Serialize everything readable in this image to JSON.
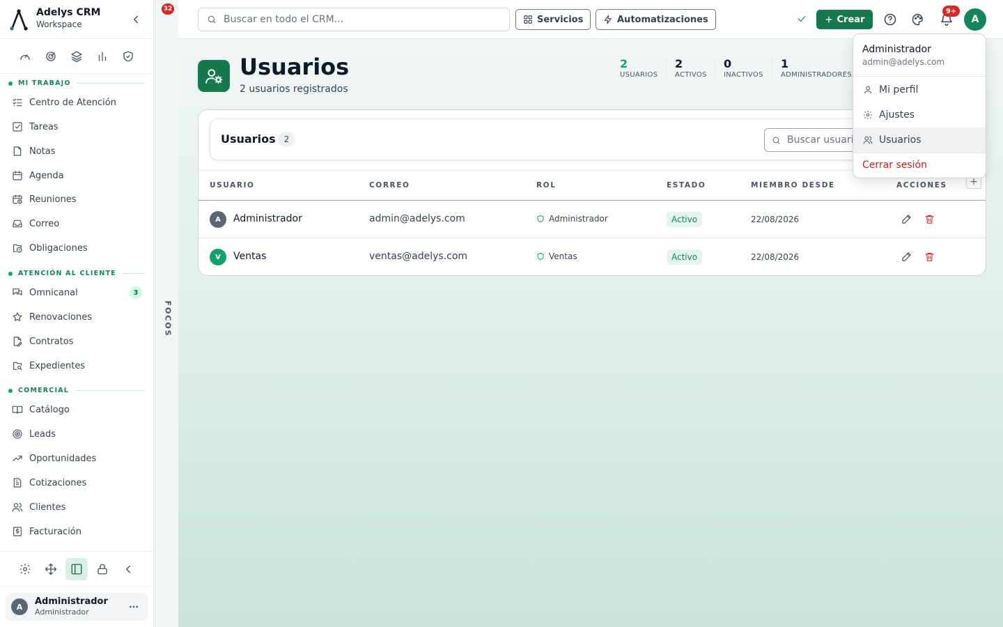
{
  "brand": {
    "name": "Adelys CRM",
    "subtitle": "Workspace"
  },
  "sidebar": {
    "sections": [
      {
        "title": "MI TRABAJO",
        "items": [
          {
            "label": "Centro de Atención",
            "icon": "list-check-icon"
          },
          {
            "label": "Tareas",
            "icon": "checkbox-icon"
          },
          {
            "label": "Notas",
            "icon": "note-icon"
          },
          {
            "label": "Agenda",
            "icon": "calendar-icon"
          },
          {
            "label": "Reuniones",
            "icon": "calendar-clock-icon"
          },
          {
            "label": "Correo",
            "icon": "inbox-icon"
          },
          {
            "label": "Obligaciones",
            "icon": "folder-clock-icon"
          }
        ]
      },
      {
        "title": "ATENCIÓN AL CLIENTE",
        "items": [
          {
            "label": "Omnicanal",
            "icon": "chat-icon",
            "badge": "3"
          },
          {
            "label": "Renovaciones",
            "icon": "star-icon"
          },
          {
            "label": "Contratos",
            "icon": "file-edit-icon"
          },
          {
            "label": "Expedientes",
            "icon": "folder-search-icon"
          }
        ]
      },
      {
        "title": "COMERCIAL",
        "items": [
          {
            "label": "Catálogo",
            "icon": "book-icon"
          },
          {
            "label": "Leads",
            "icon": "target-icon"
          },
          {
            "label": "Oportunidades",
            "icon": "trend-icon"
          },
          {
            "label": "Cotizaciones",
            "icon": "document-icon"
          },
          {
            "label": "Clientes",
            "icon": "users-icon"
          },
          {
            "label": "Facturación",
            "icon": "invoice-icon"
          }
        ]
      }
    ],
    "user": {
      "initial": "A",
      "name": "Administrador",
      "role": "Administrador"
    }
  },
  "focus": {
    "badge": "32",
    "label": "FOCOS"
  },
  "topbar": {
    "search_placeholder": "Buscar en todo el CRM...",
    "services_label": "Servicios",
    "automations_label": "Automatizaciones",
    "create_label": "Crear",
    "notifications_badge": "9+",
    "avatar_initial": "A"
  },
  "page": {
    "title": "Usuarios",
    "subtitle": "2 usuarios registrados",
    "stats": [
      {
        "value": "2",
        "label": "USUARIOS"
      },
      {
        "value": "2",
        "label": "ACTIVOS"
      },
      {
        "value": "0",
        "label": "INACTIVOS"
      },
      {
        "value": "1",
        "label": "ADMINISTRADORES"
      }
    ]
  },
  "table": {
    "title": "Usuarios",
    "count": "2",
    "search_placeholder": "Buscar usuarios...",
    "columns": [
      "USUARIO",
      "CORREO",
      "ROL",
      "ESTADO",
      "MIEMBRO DESDE",
      "ACCIONES"
    ],
    "add_column_label": "+",
    "rows": [
      {
        "initial": "A",
        "avatar_color": "#5b6573",
        "name": "Administrador",
        "email": "admin@adelys.com",
        "role": "Administrador",
        "status": "Activo",
        "since": "22/08/2026"
      },
      {
        "initial": "V",
        "avatar_color": "#15a06c",
        "name": "Ventas",
        "email": "ventas@adelys.com",
        "role": "Ventas",
        "status": "Activo",
        "since": "22/08/2026"
      }
    ]
  },
  "dropdown": {
    "name": "Administrador",
    "email": "admin@adelys.com",
    "items": [
      {
        "label": "Mi perfil",
        "icon": "user-icon"
      },
      {
        "label": "Ajustes",
        "icon": "gear-icon"
      },
      {
        "label": "Usuarios",
        "icon": "users-icon"
      }
    ],
    "logout_label": "Cerrar sesión"
  },
  "colors": {
    "brand": "#15784f",
    "accent": "#15a06c",
    "danger": "#dc2626"
  }
}
